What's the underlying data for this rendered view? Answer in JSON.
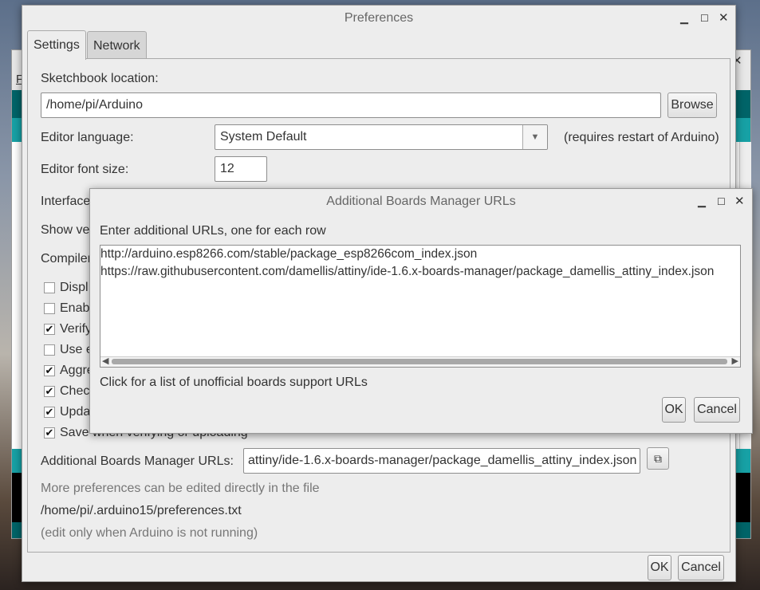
{
  "background_ide": {
    "menu_letter": "F"
  },
  "prefs": {
    "title": "Preferences",
    "tabs": [
      {
        "label": "Settings"
      },
      {
        "label": "Network"
      }
    ],
    "sketchbook_label": "Sketchbook location:",
    "sketchbook_path": "/home/pi/Arduino",
    "browse_label": "Browse",
    "editor_language_label": "Editor language:",
    "editor_language_value": "System Default",
    "restart_note": "(requires restart of Arduino)",
    "font_size_label": "Editor font size:",
    "font_size_value": "12",
    "interface_label": "Interface",
    "show_verbose_label": "Show ve",
    "compiler_label": "Compiler",
    "checkboxes": [
      {
        "label": "Displ",
        "checked": false
      },
      {
        "label": "Enab",
        "checked": false
      },
      {
        "label": "Verify",
        "checked": true
      },
      {
        "label": "Use e",
        "checked": false
      },
      {
        "label": "Aggre",
        "checked": true
      },
      {
        "label": "Checl",
        "checked": true
      },
      {
        "label": "Upda",
        "checked": true
      },
      {
        "label": "Save when verifying or uploading",
        "checked": true
      }
    ],
    "boards_url_label": "Additional Boards Manager URLs:",
    "boards_url_value": "attiny/ide-1.6.x-boards-manager/package_damellis_attiny_index.json",
    "more_prefs_text": "More preferences can be edited directly in the file",
    "prefs_file_path": "/home/pi/.arduino15/preferences.txt",
    "edit_note": "(edit only when Arduino is not running)",
    "ok_label": "OK",
    "cancel_label": "Cancel"
  },
  "dialog": {
    "title": "Additional Boards Manager URLs",
    "instruction": "Enter additional URLs, one for each row",
    "urls": [
      "http://arduino.esp8266.com/stable/package_esp8266com_index.json",
      "https://raw.githubusercontent.com/damellis/attiny/ide-1.6.x-boards-manager/package_damellis_attiny_index.json"
    ],
    "link_text": "Click for a list of unofficial boards support URLs",
    "ok_label": "OK",
    "cancel_label": "Cancel"
  },
  "icons": {
    "minimize": "minimize-icon",
    "maximize": "maximize-icon",
    "close": "close-icon",
    "dropdown": "chevron-down-icon",
    "expand_window": "window-icon",
    "checkmark": "check-icon"
  }
}
